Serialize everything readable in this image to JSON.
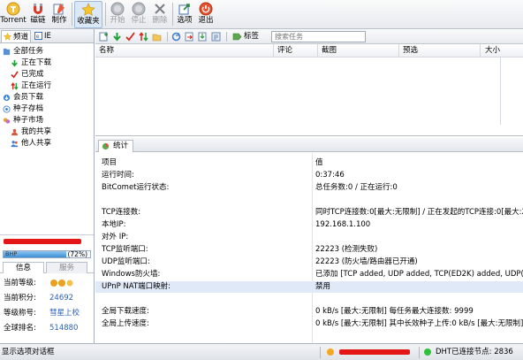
{
  "toolbar": {
    "buttons": [
      {
        "label": "Torrent",
        "icon": "torrent-icon"
      },
      {
        "label": "磁链",
        "icon": "magnet-icon"
      },
      {
        "label": "制作",
        "icon": "make-torrent-icon"
      },
      {
        "label": "收藏夹",
        "icon": "favorites-star-icon",
        "active": true
      },
      {
        "label": "开始",
        "icon": "start-icon",
        "disabled": true
      },
      {
        "label": "停止",
        "icon": "stop-icon",
        "disabled": true
      },
      {
        "label": "删除",
        "icon": "delete-icon",
        "disabled": true
      },
      {
        "label": "选项",
        "icon": "options-icon"
      },
      {
        "label": "退出",
        "icon": "exit-power-icon"
      }
    ]
  },
  "left_tabs": [
    {
      "label": "频道",
      "icon": "star-icon"
    },
    {
      "label": "IE",
      "icon": "ie-icon"
    }
  ],
  "tree": [
    {
      "label": "全部任务",
      "icon": "all-tasks-icon"
    },
    {
      "label": "正在下载",
      "icon": "download-arrow-icon"
    },
    {
      "label": "已完成",
      "icon": "checkmark-icon"
    },
    {
      "label": "正在运行",
      "icon": "running-arrows-icon"
    },
    {
      "label": "会员下载",
      "icon": "member-download-icon"
    },
    {
      "label": "种子存档",
      "icon": "torrent-archive-icon"
    },
    {
      "label": "种子市场",
      "icon": "torrent-market-icon"
    },
    {
      "label": "我的共享",
      "icon": "my-share-icon"
    },
    {
      "label": "他人共享",
      "icon": "others-share-icon"
    }
  ],
  "user": {
    "level_prefix": "BHP",
    "progress_label": "(72%)",
    "progress_fraction": 0.72,
    "tabs": [
      "信息",
      "服务"
    ],
    "rows": [
      {
        "key": "当前等级:",
        "value": ""
      },
      {
        "key": "当前积分:",
        "value": "24692"
      },
      {
        "key": "等级称号:",
        "value": "彗星上校"
      },
      {
        "key": "全球排名:",
        "value": "514880"
      }
    ]
  },
  "subbar": {
    "tag_label": "标签",
    "search_placeholder": "搜索任务"
  },
  "task_columns": [
    "名称",
    "评论",
    "截图",
    "预选",
    "大小"
  ],
  "stats": {
    "tab_label": "统计",
    "header": {
      "key": "项目",
      "value": "值"
    },
    "rows": [
      {
        "key": "运行时间:",
        "value": "0:37:46"
      },
      {
        "key": "BitComet运行状态:",
        "value": "总任务数:0 / 正在运行:0"
      },
      {
        "key": "",
        "value": ""
      },
      {
        "key": "TCP连接数:",
        "value": "同时TCP连接数:0[最大:无限制] / 正在发起的TCP连接:0[最大:200]"
      },
      {
        "key": "本地IP:",
        "value": "192.168.1.100"
      },
      {
        "key": "对外 IP:",
        "value": ""
      },
      {
        "key": "TCP监听端口:",
        "value": "22223 (检测失败)"
      },
      {
        "key": "UDP监听端口:",
        "value": "22223 (防火墙/路由器已开通)"
      },
      {
        "key": "Windows防火墙:",
        "value": "已添加 [TCP added, UDP added, TCP(ED2K) added, UDP(ED2K"
      },
      {
        "key": "UPnP NAT端口映射:",
        "value": "禁用",
        "highlight": true
      },
      {
        "key": "",
        "value": ""
      },
      {
        "key": "全局下载速度:",
        "value": "0 kB/s [最大:无限制]    每任务最大连接数: 9999"
      },
      {
        "key": "全局上传速度:",
        "value": "0 kB/s [最大:无限制]    其中长效种子上传:0 kB/s [最大:无限制]"
      }
    ]
  },
  "statusbar": {
    "hint": "显示选项对话框",
    "dht": "DHT已连接节点: 2836",
    "colors": {
      "warn": "#f5a623",
      "ok": "#2fbf3a"
    }
  }
}
